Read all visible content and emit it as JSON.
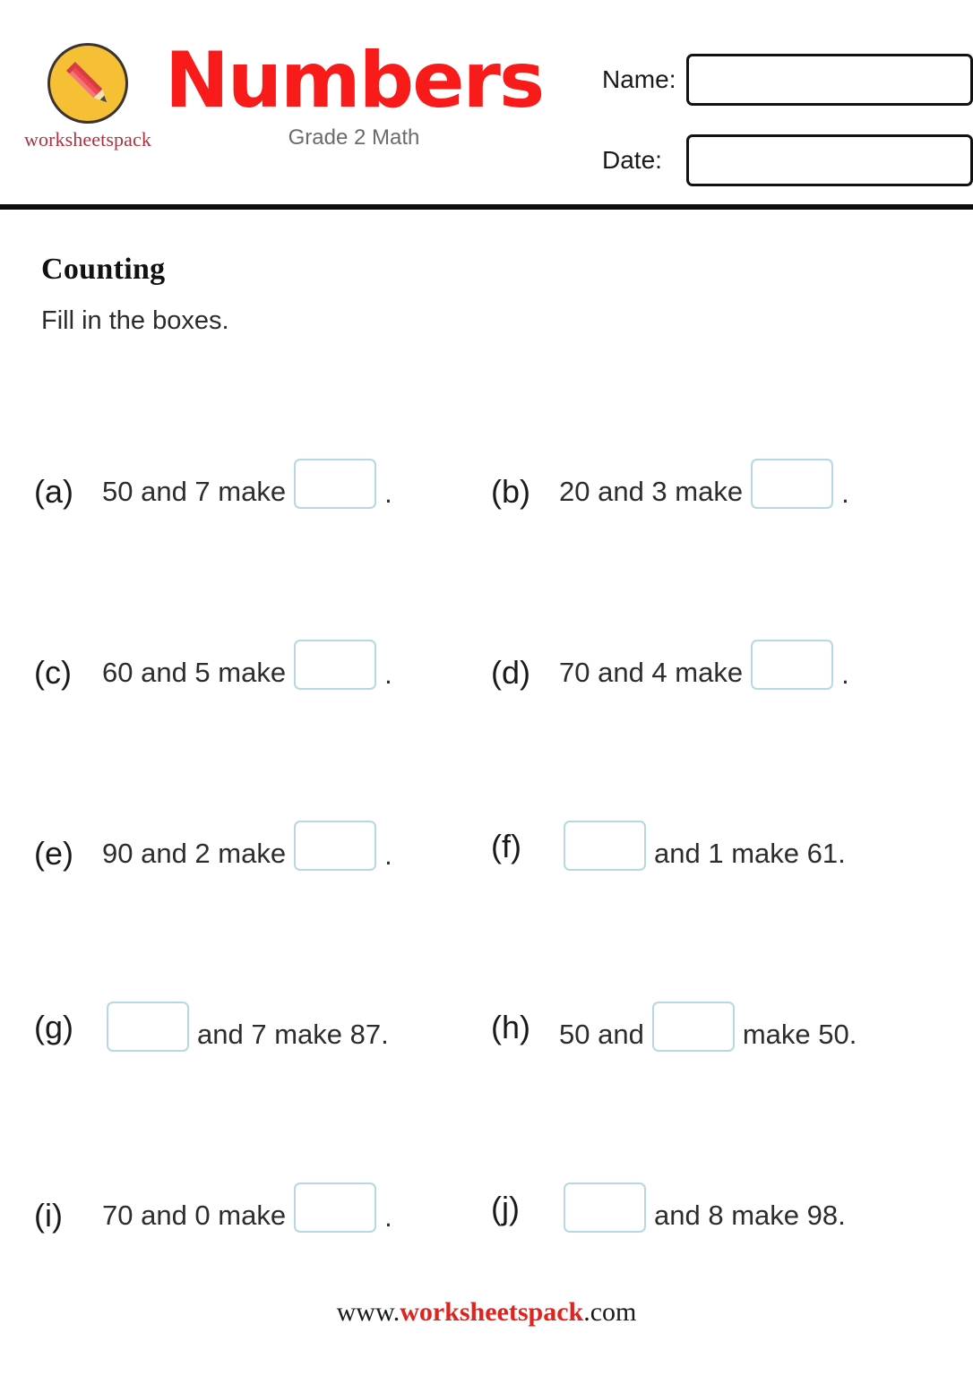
{
  "header": {
    "brand_name": "worksheetspack",
    "brand_icon": "pencil-circle-logo",
    "title": "Numbers",
    "subtitle": "Grade 2 Math",
    "fields": [
      {
        "label": "Name:",
        "value": "",
        "placeholder": ""
      },
      {
        "label": "Date:",
        "value": "",
        "placeholder": ""
      }
    ]
  },
  "section": {
    "title": "Counting",
    "instruction": "Fill in the boxes."
  },
  "questions": [
    {
      "label": "(a)",
      "before": "50 and 7 make",
      "after": ".",
      "box_position": "middle",
      "value": ""
    },
    {
      "label": "(b)",
      "before": "20 and 3 make",
      "after": ".",
      "box_position": "middle",
      "value": ""
    },
    {
      "label": "(c)",
      "before": "60 and 5 make",
      "after": ".",
      "box_position": "middle",
      "value": ""
    },
    {
      "label": "(d)",
      "before": "70 and 4 make",
      "after": ".",
      "box_position": "middle",
      "value": ""
    },
    {
      "label": "(e)",
      "before": "90 and 2 make",
      "after": ".",
      "box_position": "middle",
      "value": ""
    },
    {
      "label": "(f)",
      "before": "",
      "after": "and 1 make 61.",
      "box_position": "start",
      "value": ""
    },
    {
      "label": "(g)",
      "before": "",
      "after": "and 7 make 87.",
      "box_position": "start",
      "value": ""
    },
    {
      "label": "(h)",
      "before": "50 and",
      "after": "make 50.",
      "box_position": "middle",
      "value": ""
    },
    {
      "label": "(i)",
      "before": "70 and 0 make",
      "after": ".",
      "box_position": "middle",
      "value": ""
    },
    {
      "label": "(j)",
      "before": "",
      "after": "and 8 make 98.",
      "box_position": "start",
      "value": ""
    }
  ],
  "footer": {
    "prefix": "www.",
    "brand": "worksheetspack",
    "suffix": ".com"
  },
  "colors": {
    "title_red": "#f91a1a",
    "brand_red": "#b0303f",
    "footer_red": "#e0231e",
    "box_border": "#b6d8e2",
    "rule": "#0d0d0d",
    "logo_circle": "#f5c033",
    "subtitle_gray": "#6b6b6b"
  }
}
